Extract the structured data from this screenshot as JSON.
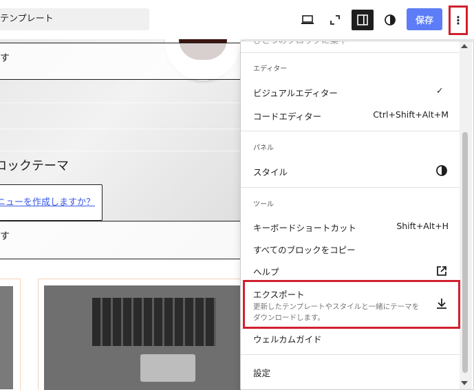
{
  "header": {
    "template_title": "テンプレート",
    "save_label": "保存",
    "more_icon": "⋮"
  },
  "canvas": {
    "top_text": "す",
    "site_title": "ロックテーマ",
    "menu_prompt": "ニューを作成しますか？",
    "bottom_text": "す"
  },
  "menu": {
    "cut_item": "ひとつのブロックに集中",
    "editor": {
      "label": "エディター",
      "visual": "ビジュアルエディター",
      "visual_check": "✓",
      "code": "コードエディター",
      "code_shortcut": "Ctrl+Shift+Alt+M"
    },
    "panel": {
      "label": "パネル",
      "style": "スタイル"
    },
    "tools": {
      "label": "ツール",
      "shortcuts": "キーボードショートカット",
      "shortcuts_key": "Shift+Alt+H",
      "copy_blocks": "すべてのブロックをコピー",
      "help": "ヘルプ",
      "export": "エクスポート",
      "export_desc": "更新したテンプレートやスタイルと一緒にテーマをダウンロードします。",
      "welcome": "ウェルカムガイド"
    },
    "settings": "設定"
  },
  "colors": {
    "save_bg": "#5c7df7",
    "highlight": "#d0202d",
    "link": "#3858e9"
  }
}
